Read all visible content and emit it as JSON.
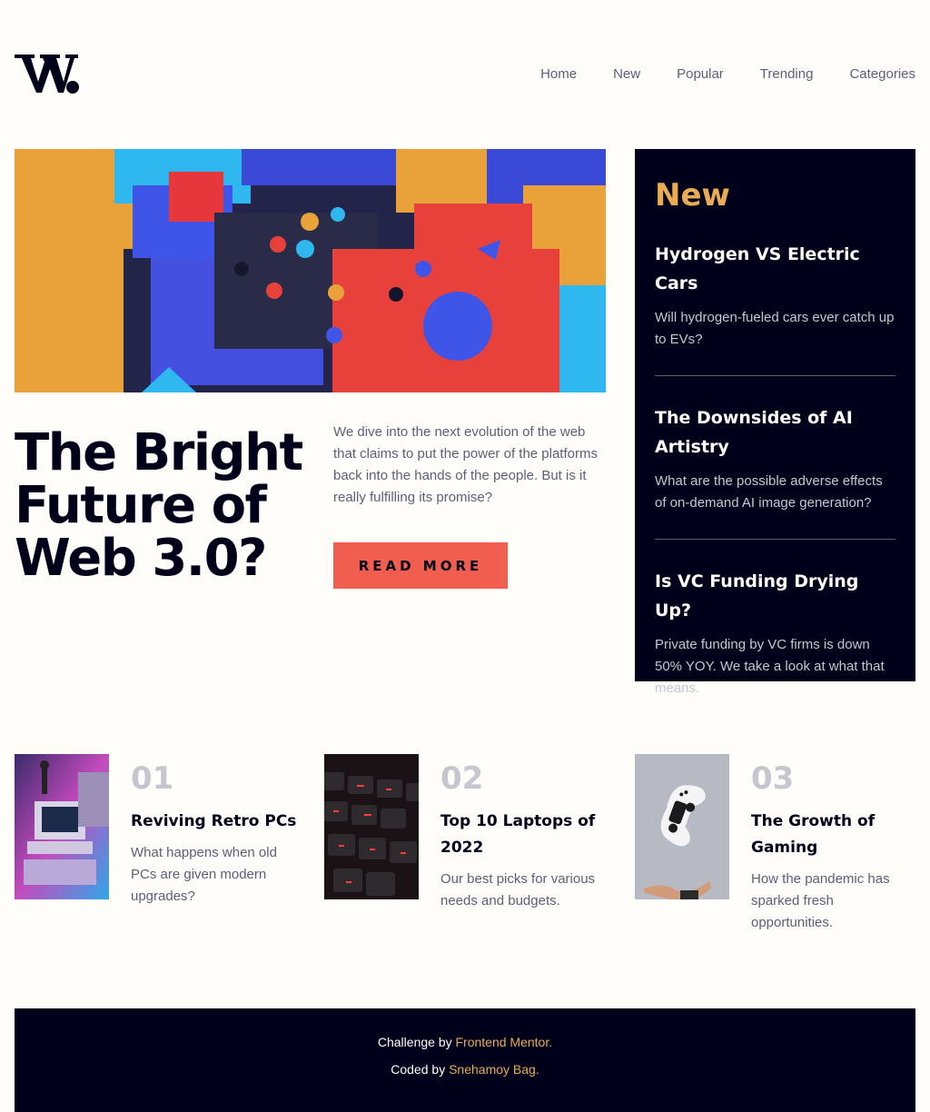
{
  "logo": {
    "text": "W."
  },
  "nav": {
    "items": [
      "Home",
      "New",
      "Popular",
      "Trending",
      "Categories"
    ]
  },
  "hero": {
    "image": "abstract-3d-blocks-image",
    "title": "The Bright Future of Web 3.0?",
    "text": "We dive into the next evolution of the web that claims to put the power of the platforms back into the hands of the people. But is it really fulfilling its promise?",
    "button": "READ MORE"
  },
  "new_panel": {
    "heading": "New",
    "items": [
      {
        "title": "Hydrogen VS Electric Cars",
        "text": "Will hydrogen-fueled cars ever catch up to EVs?"
      },
      {
        "title": "The Downsides of AI Artistry",
        "text": "What are the possible adverse effects of on-demand AI image generation?"
      },
      {
        "title": "Is VC Funding Drying Up?",
        "text": "Private funding by VC firms is down 50% YOY. We take a look at what that means."
      }
    ]
  },
  "cards": [
    {
      "number": "01",
      "title": "Reviving Retro PCs",
      "text": "What happens when old PCs are given modern upgrades?",
      "image": "retro-pc-image"
    },
    {
      "number": "02",
      "title": "Top 10 Laptops of 2022",
      "text": "Our best picks for various needs and budgets.",
      "image": "laptop-keyboard-image"
    },
    {
      "number": "03",
      "title": "The Growth of Gaming",
      "text": "How the pandemic has sparked fresh opportunities.",
      "image": "game-controller-image"
    }
  ],
  "footer": {
    "line1_prefix": "Challenge by ",
    "line1_link": "Frontend Mentor.",
    "line2_prefix": "Coded by ",
    "line2_link": "Snehamoy Bag."
  },
  "colors": {
    "background": "#FFFDFA",
    "dark": "#00001A",
    "accent_red": "#F15E50",
    "accent_orange": "#E9AB53",
    "grey": "#5D5F79"
  }
}
